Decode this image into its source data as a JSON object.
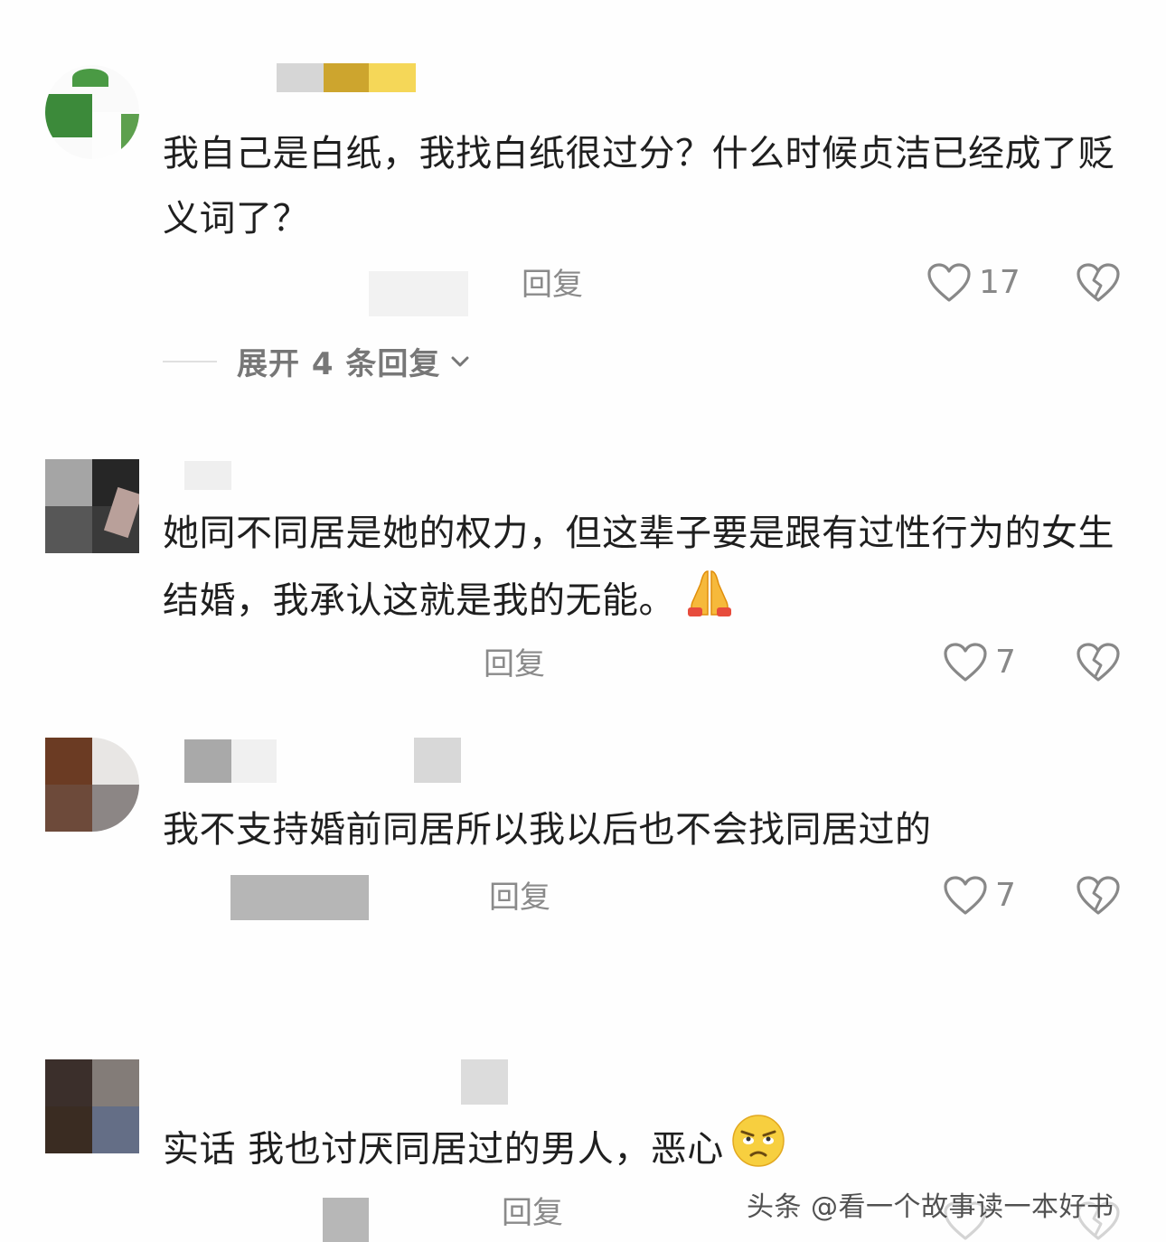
{
  "comments": [
    {
      "text": "我自己是白纸，我找白纸很过分？什么时候贞洁已经成了贬义词了？",
      "reply_label": "回复",
      "like_count": "17",
      "expand_label": "展开 4 条回复"
    },
    {
      "text": "她同不同居是她的权力，但这辈子要是跟有过性行为的女生结婚，我承认这就是我的无能。",
      "emoji": "praying-hands-emoji",
      "reply_label": "回复",
      "like_count": "7"
    },
    {
      "text": "我不支持婚前同居所以我以后也不会找同居过的",
      "reply_label": "回复",
      "like_count": "7"
    },
    {
      "text": "实话 我也讨厌同居过的男人，恶心",
      "emoji": "eye-roll-face-emoji",
      "reply_label": "回复"
    }
  ],
  "watermark": "头条 @看一个故事读一本好书",
  "icons": {
    "like": "heart-outline-icon",
    "dislike": "broken-heart-icon",
    "expand": "chevron-down-icon"
  },
  "colors": {
    "text": "#1f1f1f",
    "meta": "#8a8a8a",
    "background": "#fefefe"
  }
}
